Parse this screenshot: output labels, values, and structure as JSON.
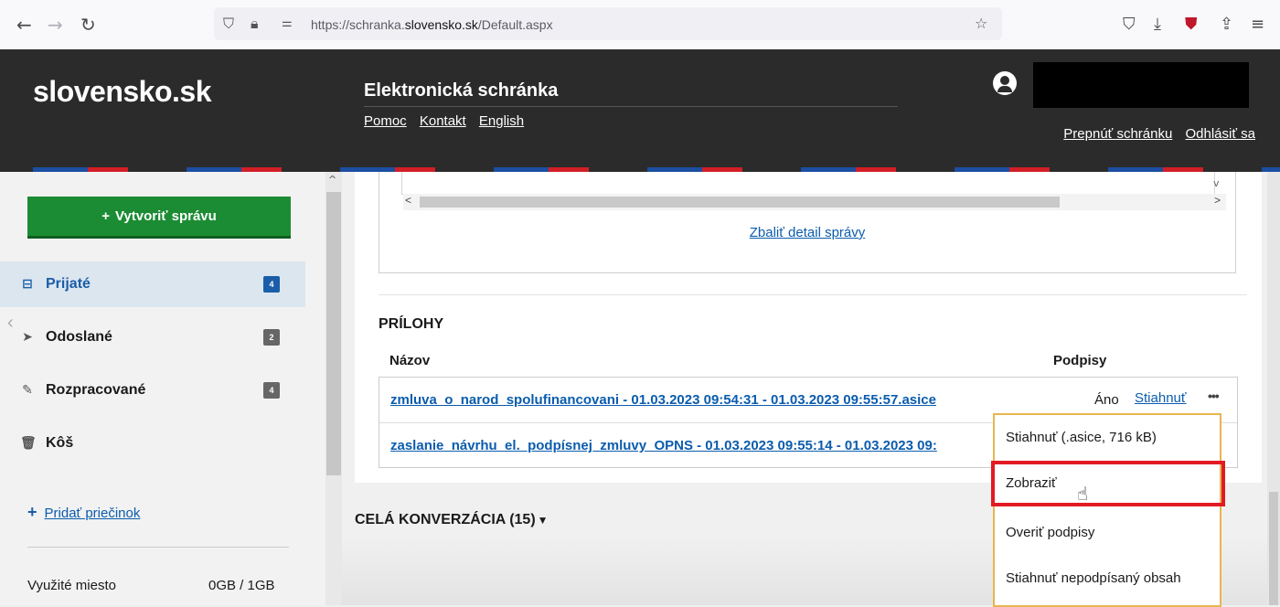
{
  "browser": {
    "url_prefix": "https://schranka.",
    "url_domain": "slovensko.sk",
    "url_suffix": "/Default.aspx"
  },
  "header": {
    "logo": "slovensko.sk",
    "title": "Elektronická schránka",
    "links": [
      "Pomoc",
      "Kontakt",
      "English"
    ],
    "switch_mailbox": "Prepnúť schránku",
    "logout": "Odhlásiť sa"
  },
  "sidebar": {
    "create_button": "Vytvoriť správu",
    "items": [
      {
        "label": "Prijaté",
        "count": "4",
        "icon": "inbox-icon"
      },
      {
        "label": "Odoslané",
        "count": "2",
        "icon": "paper-plane-icon"
      },
      {
        "label": "Rozpracované",
        "count": "4",
        "icon": "pencil-icon"
      },
      {
        "label": "Kôš",
        "count": "",
        "icon": "trash-icon"
      }
    ],
    "add_folder": "Pridať priečinok",
    "usage_label": "Využité miesto",
    "usage_value": "0GB / 1GB"
  },
  "main": {
    "collapse_detail": "Zbaliť detail správy",
    "attachments_title": "PRÍLOHY",
    "col_name": "Názov",
    "col_signatures": "Podpisy",
    "attachments": [
      {
        "name": "zmluva_o_narod_spolufinancovani - 01.03.2023 09:54:31 - 01.03.2023 09:55:57.asice",
        "signed": "Áno",
        "download": "Stiahnuť",
        "more": "•••"
      },
      {
        "name": "zaslanie_návrhu_el._podpísnej_zmluvy_OPNS - 01.03.2023 09:55:14 - 01.03.2023 09:",
        "signed": "",
        "download": "",
        "more": ""
      }
    ],
    "conversation": "CELÁ KONVERZÁCIA (15)"
  },
  "dropdown": {
    "items": [
      "Stiahnuť (.asice, 716 kB)",
      "Zobraziť",
      "Overiť podpisy",
      "Stiahnuť nepodpísaný obsah"
    ],
    "highlight_color": "#e21b22",
    "border_color": "#e8b64e"
  }
}
